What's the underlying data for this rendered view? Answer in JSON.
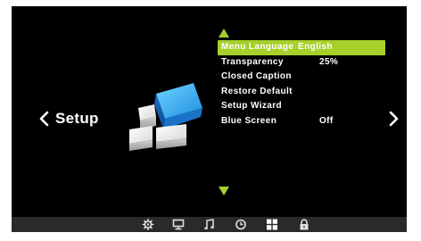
{
  "osd": {
    "section_title": "Setup",
    "nav_prev_icon": "chevron-left-icon",
    "nav_next_icon": "chevron-right-icon",
    "scroll_up_icon": "triangle-up-icon",
    "scroll_down_icon": "triangle-down-icon",
    "accent_color": "#a6d02a",
    "menu": [
      {
        "label": "Menu Language",
        "value": "English",
        "selected": true
      },
      {
        "label": "Transparency",
        "value": "25%",
        "selected": false
      },
      {
        "label": "Closed Caption",
        "value": "",
        "selected": false
      },
      {
        "label": "Restore Default",
        "value": "",
        "selected": false
      },
      {
        "label": "Setup Wizard",
        "value": "",
        "selected": false
      },
      {
        "label": "Blue Screen",
        "value": "Off",
        "selected": false
      }
    ],
    "tabs": [
      {
        "icon": "gear-icon",
        "label": "Picture settings"
      },
      {
        "icon": "monitor-icon",
        "label": "Screen"
      },
      {
        "icon": "music-note-icon",
        "label": "Sound"
      },
      {
        "icon": "clock-icon",
        "label": "Time"
      },
      {
        "icon": "grid-icon",
        "label": "Setup"
      },
      {
        "icon": "lock-icon",
        "label": "Lock"
      }
    ],
    "active_tab": "grid-icon"
  }
}
